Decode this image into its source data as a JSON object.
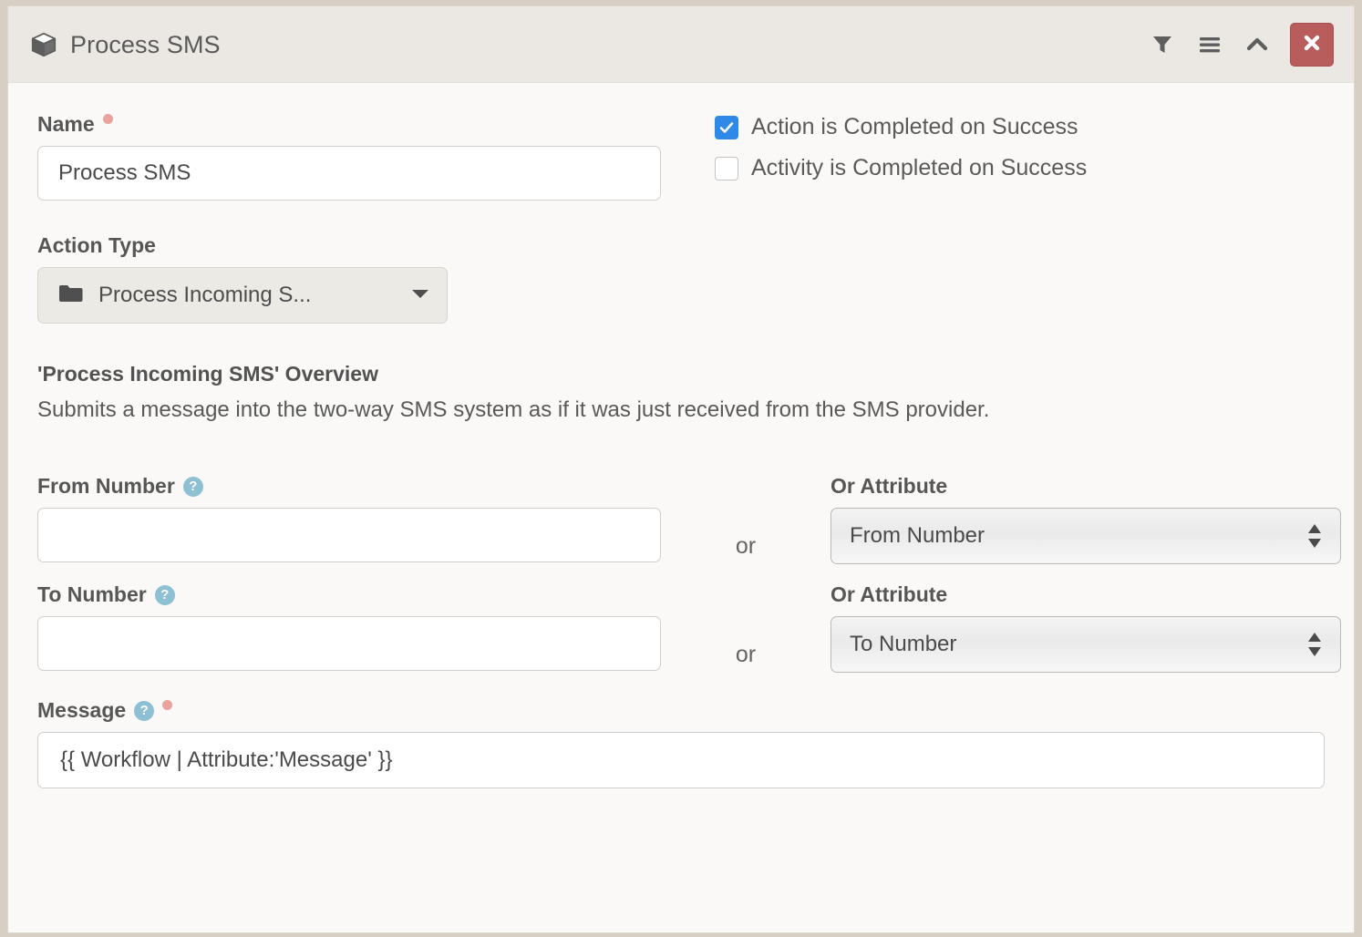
{
  "header": {
    "title": "Process SMS",
    "icon": "cube-icon",
    "actions": [
      {
        "name": "filter-icon",
        "label": "Filter"
      },
      {
        "name": "menu-icon",
        "label": "Menu"
      },
      {
        "name": "chevron-up-icon",
        "label": "Collapse"
      }
    ],
    "close_label": "✕"
  },
  "colors": {
    "outer_background": "#d8cfc4",
    "panel_background": "#faf9f7",
    "header_background": "#ebe8e3",
    "close_button": "#b85c5c",
    "checkbox_checked": "#2e8ae6",
    "help_icon": "#8ec0d4",
    "required_dot": "#e8a39c"
  },
  "form": {
    "name_label": "Name",
    "name_value": "Process SMS",
    "name_placeholder": "",
    "checkboxes": [
      {
        "label": "Action is Completed on Success",
        "checked": true
      },
      {
        "label": "Activity is Completed on Success",
        "checked": false
      }
    ],
    "action_type_label": "Action Type",
    "action_type_value": "Process Incoming S...",
    "overview_title": "'Process Incoming SMS' Overview",
    "overview_description": "Submits a message into the two-way SMS system as if it was just received from the SMS provider.",
    "or_separator": "or",
    "from_number": {
      "label": "From Number",
      "value": "",
      "placeholder": "",
      "attribute_label": "Or Attribute",
      "attribute_value": "From Number"
    },
    "to_number": {
      "label": "To Number",
      "value": "",
      "placeholder": "",
      "attribute_label": "Or Attribute",
      "attribute_value": "To Number"
    },
    "message": {
      "label": "Message",
      "value": "{{ Workflow | Attribute:'Message' }}",
      "placeholder": ""
    }
  }
}
